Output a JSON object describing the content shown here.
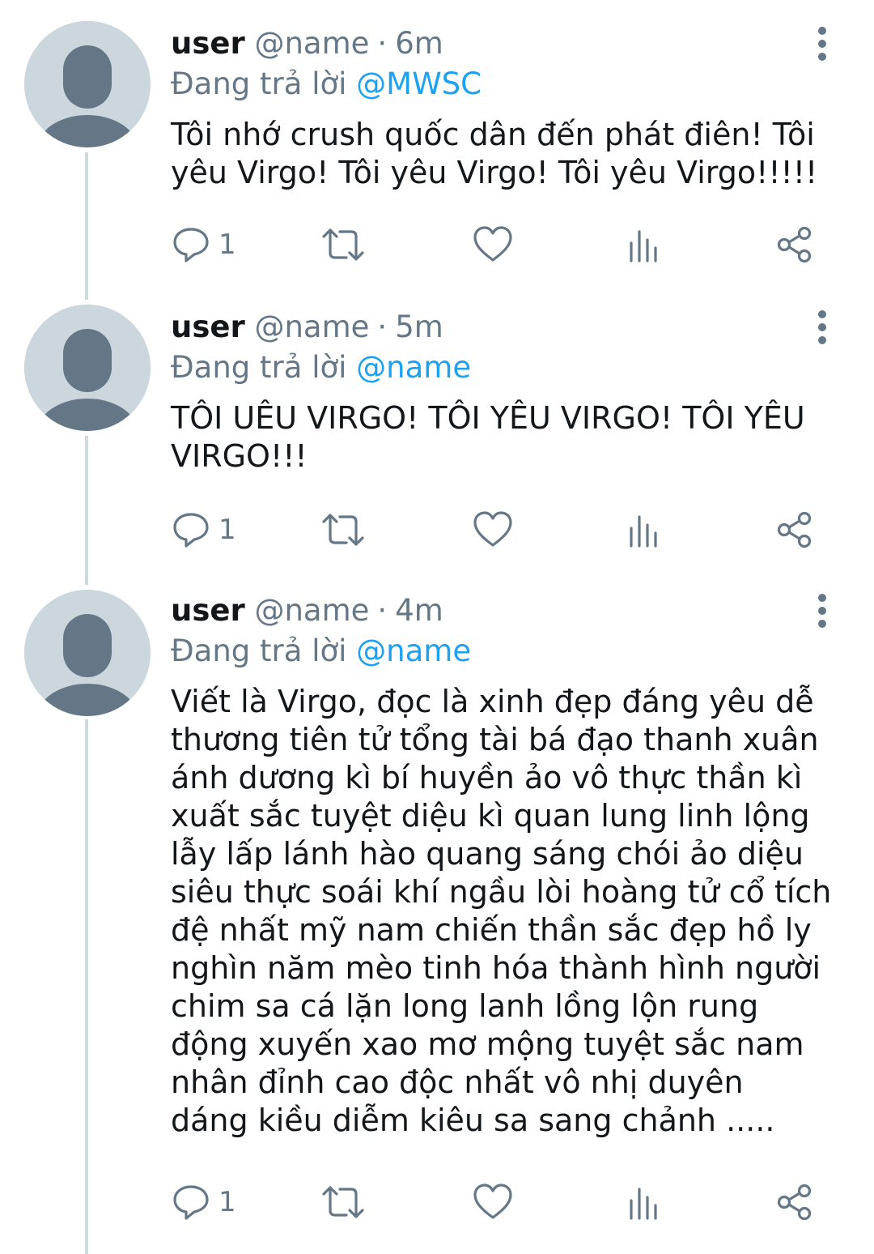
{
  "tweets": [
    {
      "username": "user",
      "handle": "@name",
      "separator": "·",
      "time": "6m",
      "reply_prefix": "Đang trả lời",
      "reply_to": "@MWSC",
      "text": "Tôi nhớ crush quốc dân đến phát điên! Tôi\nyêu Virgo! Tôi yêu Virgo! Tôi yêu Virgo!!!!!",
      "reply_count": "1",
      "icons": [
        "reply-icon",
        "retweet-icon",
        "like-icon",
        "analytics-icon",
        "share-icon",
        "more-icon"
      ]
    },
    {
      "username": "user",
      "handle": "@name",
      "separator": "·",
      "time": "5m",
      "reply_prefix": "Đang trả lời",
      "reply_to": "@name",
      "text": "TÔI UÊU VIRGO! TÔI YÊU VIRGO! TÔI YÊU\nVIRGO!!!",
      "reply_count": "1",
      "icons": [
        "reply-icon",
        "retweet-icon",
        "like-icon",
        "analytics-icon",
        "share-icon",
        "more-icon"
      ]
    },
    {
      "username": "user",
      "handle": "@name",
      "separator": "·",
      "time": "4m",
      "reply_prefix": "Đang trả lời",
      "reply_to": "@name",
      "text": "Viết là Virgo, đọc là xinh đẹp đáng yêu dễ\nthương tiên tử tổng tài bá đạo thanh xuân\nánh dương kì bí huyền ảo vô thực thần kì\nxuất sắc tuyệt diệu kì quan lung linh lộng\nlẫy lấp lánh hào quang sáng chói ảo diệu\nsiêu thực soái khí ngầu lòi hoàng tử cổ tích\nđệ nhất mỹ nam chiến thần sắc đẹp hồ ly\nnghìn năm mèo tinh hóa thành hình người\nchim sa cá lặn long lanh lồng lộn rung\nđộng xuyến xao mơ mộng tuyệt sắc nam\nnhân đỉnh cao độc nhất vô nhị duyên\ndáng kiều diễm kiêu sa sang chảnh .....",
      "reply_count": "1",
      "icons": [
        "reply-icon",
        "retweet-icon",
        "like-icon",
        "analytics-icon",
        "share-icon",
        "more-icon"
      ]
    }
  ],
  "colors": {
    "link": "#1da1f2",
    "secondary_text": "#657786",
    "primary_text": "#14171a",
    "avatar_bg": "#ccd6dd",
    "avatar_fg": "#657786",
    "thread_line": "#cfd9de"
  }
}
